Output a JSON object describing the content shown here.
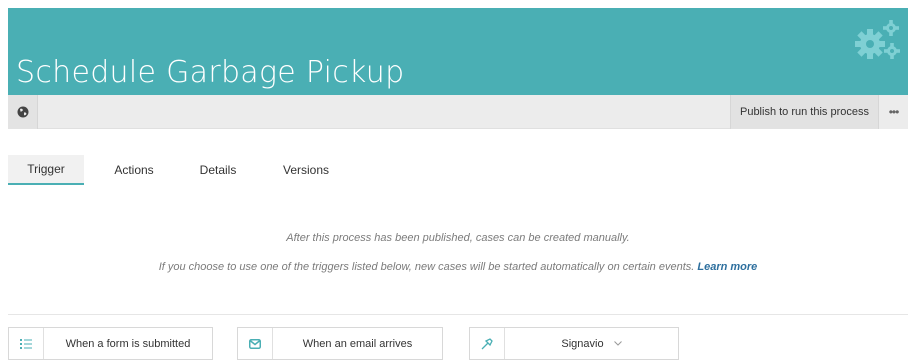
{
  "header": {
    "title": "Schedule Garbage Pickup",
    "bg_color": "#4aafb4",
    "logo_icon": "gears-icon"
  },
  "toolbar": {
    "globe_icon": "globe-icon",
    "publish_label": "Publish to run this process",
    "more_label": "•••"
  },
  "tabs": [
    {
      "label": "Trigger",
      "active": true
    },
    {
      "label": "Actions",
      "active": false
    },
    {
      "label": "Details",
      "active": false
    },
    {
      "label": "Versions",
      "active": false
    }
  ],
  "info": {
    "line1": "After this process has been published, cases can be created manually.",
    "line2": "If you choose to use one of the triggers listed below, new cases will be started automatically on certain events.",
    "learn_more": "Learn more"
  },
  "triggers": [
    {
      "label": "When a form is submitted",
      "icon": "list-icon"
    },
    {
      "label": "When an email arrives",
      "icon": "envelope-icon"
    },
    {
      "label": "Signavio",
      "icon": "signavio-icon",
      "has_dropdown": true
    }
  ],
  "colors": {
    "accent": "#4aafb4",
    "link": "#2d6f9e",
    "muted_text": "#7b7b7b"
  }
}
